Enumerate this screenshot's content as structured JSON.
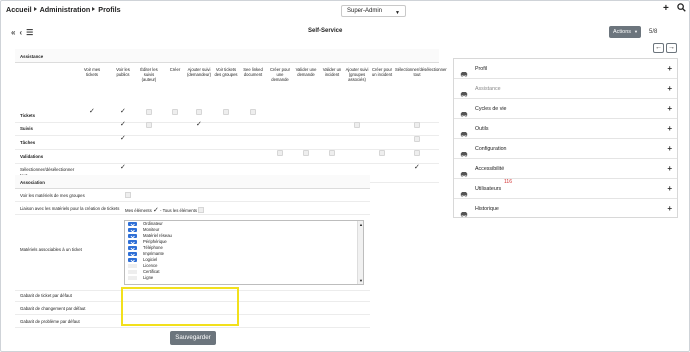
{
  "breadcrumb": [
    "Accueil",
    "Administration",
    "Profils"
  ],
  "profile_selector": "Super-Admin",
  "nav_arrows": [
    "«",
    "‹"
  ],
  "page_title": "Self-Service",
  "actions_label": "Actions",
  "pager": "5/8",
  "pager_buttons": [
    "←",
    "→"
  ],
  "assistance": {
    "title": "Assistance",
    "columns": [
      "Voir mes tickets",
      "Voir les publics",
      "Éditer les suivis (auteur)",
      "Créer",
      "Ajouter suivi (demandeur)",
      "Voir tickets des groupes",
      "See linked document",
      "Créer pour une demande",
      "Valider une demande",
      "Valider un incident",
      "Ajouter suivi (groupes associés)",
      "Créer pour un incident",
      "Sélectionner/désélectionner tout"
    ],
    "rows": [
      {
        "label": "Tickets",
        "cells": [
          "check",
          "check",
          "box",
          "box",
          "box",
          "box",
          "box",
          "",
          "",
          "",
          "",
          "",
          ""
        ]
      },
      {
        "label": "Suivis",
        "cells": [
          "",
          "check",
          "box",
          "",
          "check",
          "",
          "",
          "",
          "",
          "",
          "box",
          "",
          "box"
        ]
      },
      {
        "label": "Tâches",
        "cells": [
          "",
          "check",
          "",
          "",
          "",
          "",
          "",
          "",
          "",
          "",
          "",
          "",
          "box"
        ]
      },
      {
        "label": "Validations",
        "cells": [
          "",
          "",
          "",
          "",
          "",
          "",
          "",
          "box",
          "box",
          "box",
          "",
          "box",
          "box"
        ]
      },
      {
        "label": "Sélectionner/désélectionner tout",
        "cells": [
          "",
          "check",
          "",
          "",
          "",
          "",
          "",
          "",
          "",
          "",
          "",
          "",
          "check"
        ]
      }
    ]
  },
  "association": {
    "title": "Association",
    "see_group_items": "Voir les matériels de mes groupes",
    "link_items": "Liaison avec les matériels pour la création de tickets",
    "my_items": "Mes éléments",
    "all_items": "- Tous les éléments",
    "associable_label": "Matériels associables à un ticket",
    "associable_items": [
      {
        "label": "Ordinateur",
        "checked": true
      },
      {
        "label": "Moniteur",
        "checked": true
      },
      {
        "label": "Matériel réseau",
        "checked": true
      },
      {
        "label": "Périphérique",
        "checked": true
      },
      {
        "label": "Téléphone",
        "checked": true
      },
      {
        "label": "Imprimante",
        "checked": true
      },
      {
        "label": "Logiciel",
        "checked": true
      },
      {
        "label": "Licence",
        "checked": false
      },
      {
        "label": "Certificat",
        "checked": false
      },
      {
        "label": "Ligne",
        "checked": false
      }
    ],
    "ticket_template": "Gabarit de ticket par défaut",
    "change_template": "Gabarit de changement par défaut",
    "problem_template": "Gabarit de problème par défaut"
  },
  "save_label": "Sauvegarder",
  "sidebar": [
    {
      "label": "Profil",
      "muted": false
    },
    {
      "label": "Assistance",
      "muted": true
    },
    {
      "label": "Cycles de vie",
      "muted": false
    },
    {
      "label": "Outils",
      "muted": false
    },
    {
      "label": "Configuration",
      "muted": false
    },
    {
      "label": "Accessibilité",
      "muted": false
    },
    {
      "label": "Utilisateurs",
      "muted": false,
      "badge": "116"
    },
    {
      "label": "Historique",
      "muted": false
    }
  ],
  "icons": {
    "sidebar": "car-icon",
    "add": "plus-icon",
    "search": "search-icon"
  },
  "colors": {
    "actions_bg": "#6c757d",
    "checkbox_blue": "#2f6fd6",
    "highlight_yellow": "#f2e01c",
    "badge_red": "#d32f2f"
  }
}
